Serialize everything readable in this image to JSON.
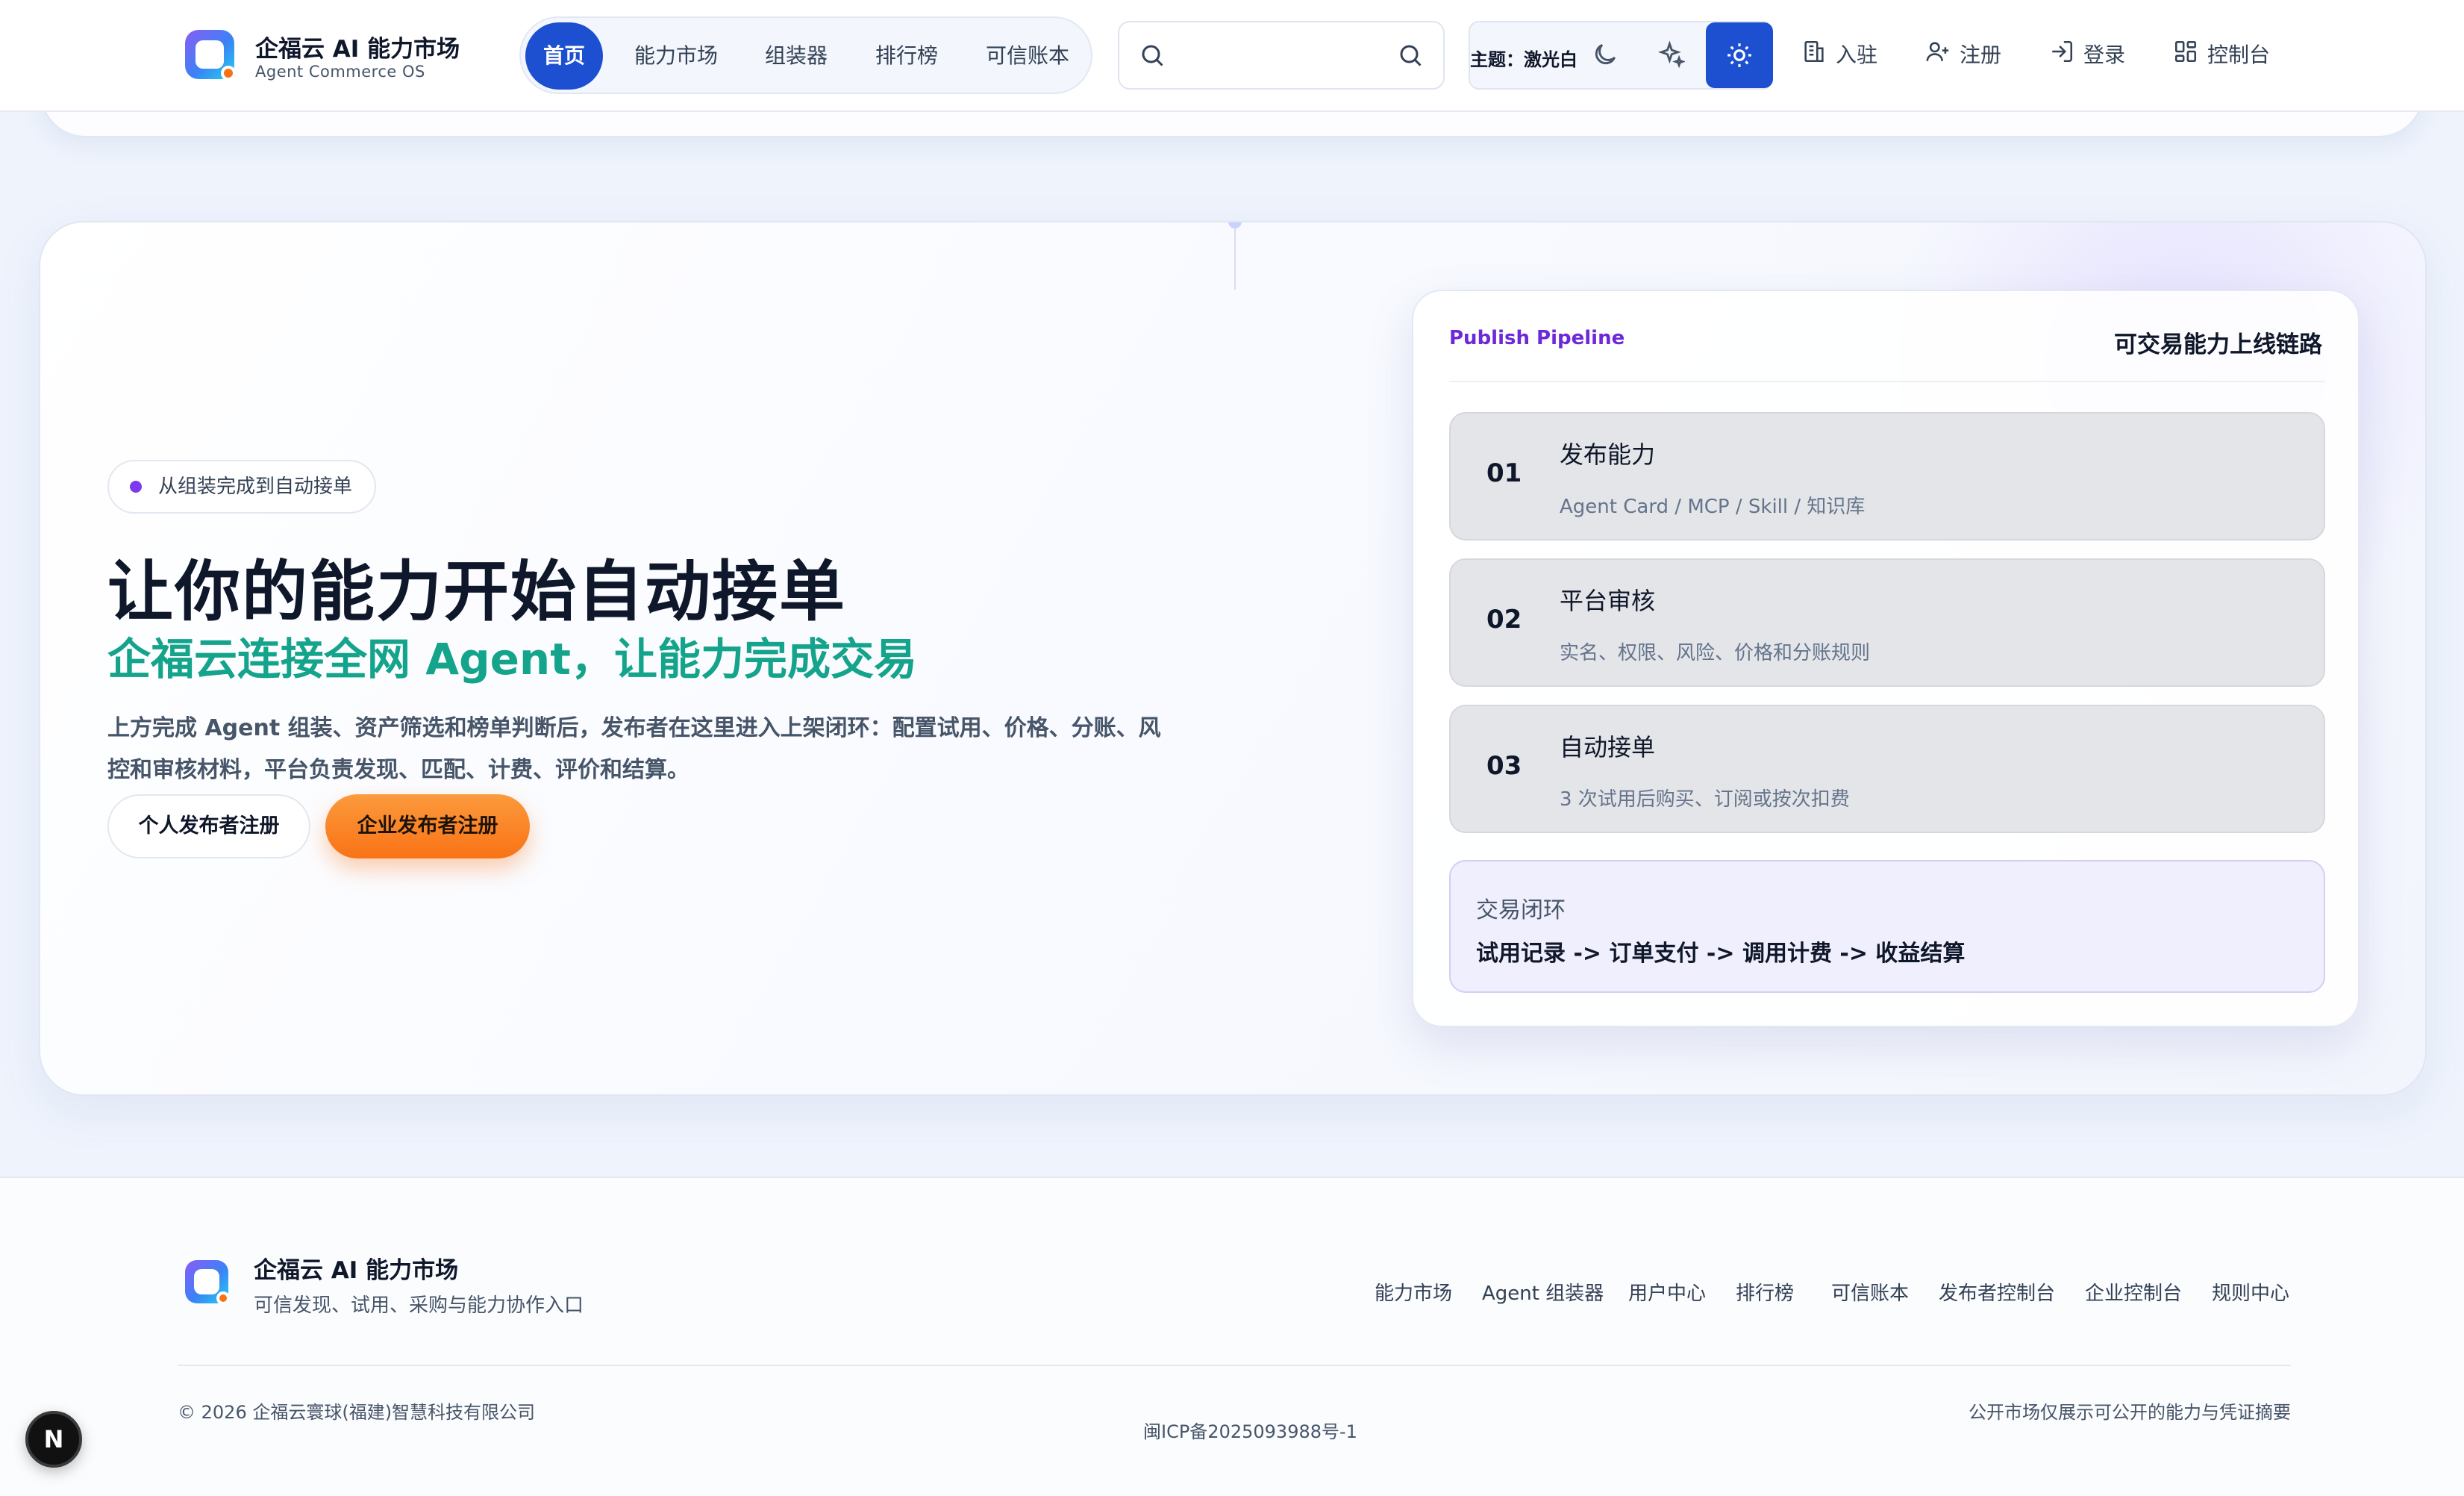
{
  "header": {
    "brand_title": "企福云 AI 能力市场",
    "brand_subtitle": "Agent Commerce OS",
    "nav": [
      {
        "label": "首页",
        "active": true
      },
      {
        "label": "能力市场",
        "active": false
      },
      {
        "label": "组装器",
        "active": false
      },
      {
        "label": "排行榜",
        "active": false
      },
      {
        "label": "可信账本",
        "active": false
      }
    ],
    "search": {
      "placeholder": "",
      "value": ""
    },
    "theme": {
      "label": "主题：激光白"
    },
    "links": {
      "join": "入驻",
      "register": "注册",
      "login": "登录",
      "console": "控制台"
    }
  },
  "hero": {
    "badge": "从组装完成到自动接单",
    "title": "让你的能力开始自动接单",
    "subtitle": "企福云连接全网 Agent，让能力完成交易",
    "description": "上方完成 Agent 组装、资产筛选和榜单判断后，发布者在这里进入上架闭环：配置试用、价格、分账、风控和审核材料，平台负责发现、匹配、计费、评价和结算。",
    "btn_personal": "个人发布者注册",
    "btn_enterprise": "企业发布者注册"
  },
  "pipeline": {
    "label": "Publish Pipeline",
    "title": "可交易能力上线链路",
    "steps": [
      {
        "num": "01",
        "title": "发布能力",
        "desc": "Agent Card / MCP / Skill / 知识库"
      },
      {
        "num": "02",
        "title": "平台审核",
        "desc": "实名、权限、风险、价格和分账规则"
      },
      {
        "num": "03",
        "title": "自动接单",
        "desc": "3 次试用后购买、订阅或按次扣费"
      }
    ],
    "loop_title": "交易闭环",
    "loop_flow": "试用记录 -> 订单支付 -> 调用计费 -> 收益结算"
  },
  "footer": {
    "brand": "企福云 AI 能力市场",
    "subtitle": "可信发现、试用、采购与能力协作入口",
    "links": [
      "能力市场",
      "Agent 组装器",
      "用户中心",
      "排行榜",
      "可信账本",
      "发布者控制台",
      "企业控制台",
      "规则中心"
    ],
    "copyright": "© 2026 企福云寰球(福建)智慧科技有限公司",
    "icp": "闽ICP备2025093988号-1",
    "disclaimer": "公开市场仅展示可公开的能力与凭证摘要"
  },
  "dev_badge": "N",
  "colors": {
    "accent": "#1d4fd1",
    "green": "#14a38b",
    "orange": "#f97316",
    "purple": "#6d28d9"
  }
}
